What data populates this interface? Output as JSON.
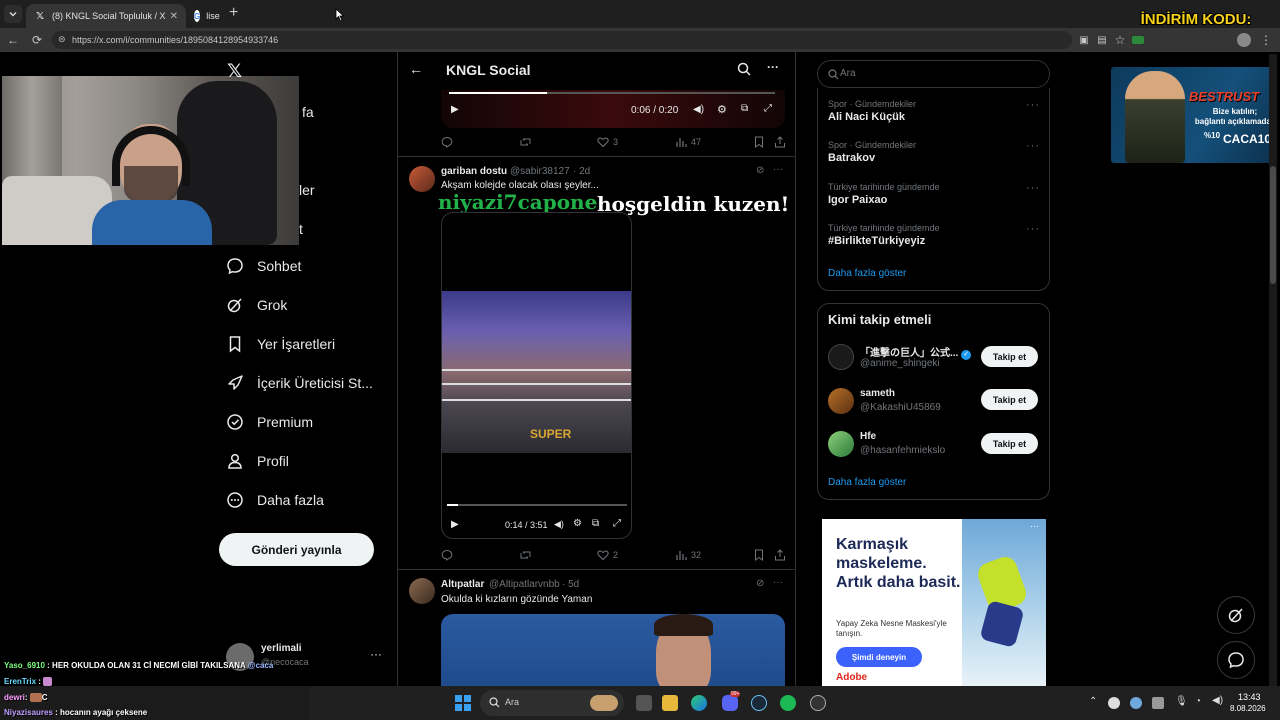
{
  "browser": {
    "tab_active": "(8) KNGL Social Topluluk / X",
    "tab_inactive": "lise",
    "url": "https://x.com/i/communities/1895084128954933746"
  },
  "stream": {
    "promo_text": "İNDİRİM KODU: ÇAÇA",
    "ad_brand": "BESTRUST",
    "ad_line1": "Bize katılın;",
    "ad_line2": "bağlantı açıklamada.",
    "ad_discount": "%10",
    "ad_code": "CACA10"
  },
  "sidebar": {
    "partial_items": [
      "fa",
      "ler",
      "t"
    ],
    "items": [
      {
        "label": "Sohbet",
        "icon": "chat-icon"
      },
      {
        "label": "Grok",
        "icon": "grok-icon"
      },
      {
        "label": "Yer İşaretleri",
        "icon": "bookmark-icon"
      },
      {
        "label": "İçerik Üreticisi St...",
        "icon": "rocket-icon"
      },
      {
        "label": "Premium",
        "icon": "premium-icon"
      },
      {
        "label": "Profil",
        "icon": "profile-icon"
      },
      {
        "label": "Daha fazla",
        "icon": "more-icon"
      }
    ],
    "post_button": "Gönderi yayınla",
    "account_name": "yerlimali",
    "account_handle": "@necocaca"
  },
  "header": {
    "title": "KNGL Social"
  },
  "post0": {
    "time": "0:06 / 0:20",
    "likes": "3",
    "views": "47"
  },
  "post1": {
    "name": "gariban dostu",
    "handle": "@sabir38127",
    "age": "· 2d",
    "text": "Akşam kolejde olacak olası şeyler...",
    "caption_green": "niyazi7capone",
    "caption_white": "hoşgeldin kuzen!",
    "video_overlay": "SUPER",
    "time": "0:14 / 3:51",
    "likes": "2",
    "views": "32"
  },
  "post2": {
    "name": "Altıpatlar",
    "handle": "@Altipatlarvnbb",
    "age": "· 5d",
    "text": "Okulda ki kızların gözünde Yaman"
  },
  "search": {
    "placeholder": "Ara"
  },
  "trends": [
    {
      "category": "Spor · Gündemdekiler",
      "name": "Ali Naci Küçük"
    },
    {
      "category": "Spor · Gündemdekiler",
      "name": "Batrakov"
    },
    {
      "category": "Türkiye tarihinde gündemde",
      "name": "Igor Paixao"
    },
    {
      "category": "Türkiye tarihinde gündemde",
      "name": "#BirlikteTürkiyeyiz"
    }
  ],
  "trends_more": "Daha fazla göster",
  "who_to_follow": {
    "title": "Kimi takip etmeli",
    "users": [
      {
        "name": "「進撃の巨人」公式...",
        "handle": "@anime_shingeki",
        "verified": true
      },
      {
        "name": "sameth",
        "handle": "@KakashiU45869"
      },
      {
        "name": "Hfe",
        "handle": "@hasanfehmiekslo"
      }
    ],
    "follow_label": "Takip et",
    "more": "Daha fazla göster"
  },
  "ad": {
    "headline": "Karmaşık maskeleme. Artık daha basit.",
    "body": "Yapay Zeka Nesne Maskesi'yle tanışın.",
    "cta": "Şimdi deneyin",
    "brand": "Adobe"
  },
  "chat": [
    {
      "user": "Yaso_6910",
      "msg": "HER OKULDA OLAN 31 Cİ NECMİ GİBİ TAKILSANA",
      "mention": "@caca",
      "color": "#7fff7f"
    },
    {
      "user": "ErenTrix",
      "msg": "",
      "color": "#66d9ff"
    },
    {
      "user": "dewri",
      "msg": "C",
      "color": "#ffa0ff"
    },
    {
      "user": "Niyazisaures",
      "msg": "hocanın ayağı çeksene",
      "color": "#c0a0ff"
    }
  ],
  "taskbar": {
    "search": "Ara",
    "time": "13:43",
    "date": "8.08.2026",
    "badge": "99+"
  },
  "colors": {
    "accent": "#1d9bf0",
    "bg": "#000000",
    "border": "#2f3336"
  }
}
